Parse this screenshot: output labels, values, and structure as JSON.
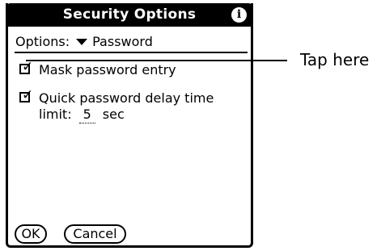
{
  "dialog": {
    "title": "Security Options",
    "info_icon": "info-icon"
  },
  "options": {
    "label": "Options:",
    "selected": "Password"
  },
  "checkboxes": [
    {
      "label": "Mask password entry",
      "checked": true
    },
    {
      "label_line1": "Quick password delay time",
      "label_line2_prefix": "limit:",
      "value": "5",
      "unit": "sec",
      "checked": true
    }
  ],
  "buttons": {
    "ok": "OK",
    "cancel": "Cancel"
  },
  "callout": {
    "text": "Tap here"
  }
}
